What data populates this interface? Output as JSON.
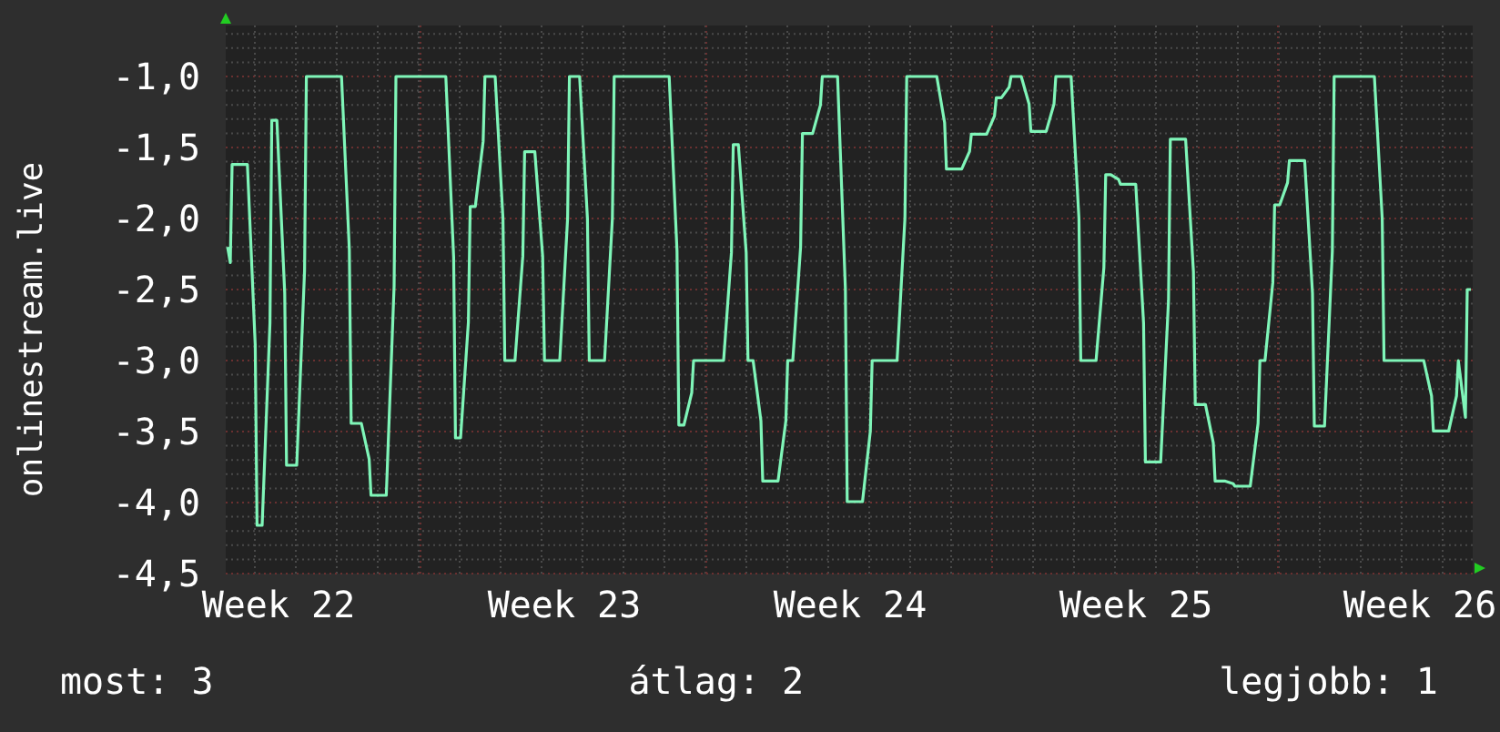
{
  "graph": {
    "y_axis_title": "onlinestream.live",
    "y_tick_labels": [
      "-1,0",
      "-1,5",
      "-2,0",
      "-2,5",
      "-3,0",
      "-3,5",
      "-4,0",
      "-4,5"
    ],
    "x_tick_labels": [
      "Week 22",
      "Week 23",
      "Week 24",
      "Week 25",
      "Week 26"
    ]
  },
  "legend": [
    "most: 3",
    "átlag: 2",
    "legjobb: 1"
  ]
}
